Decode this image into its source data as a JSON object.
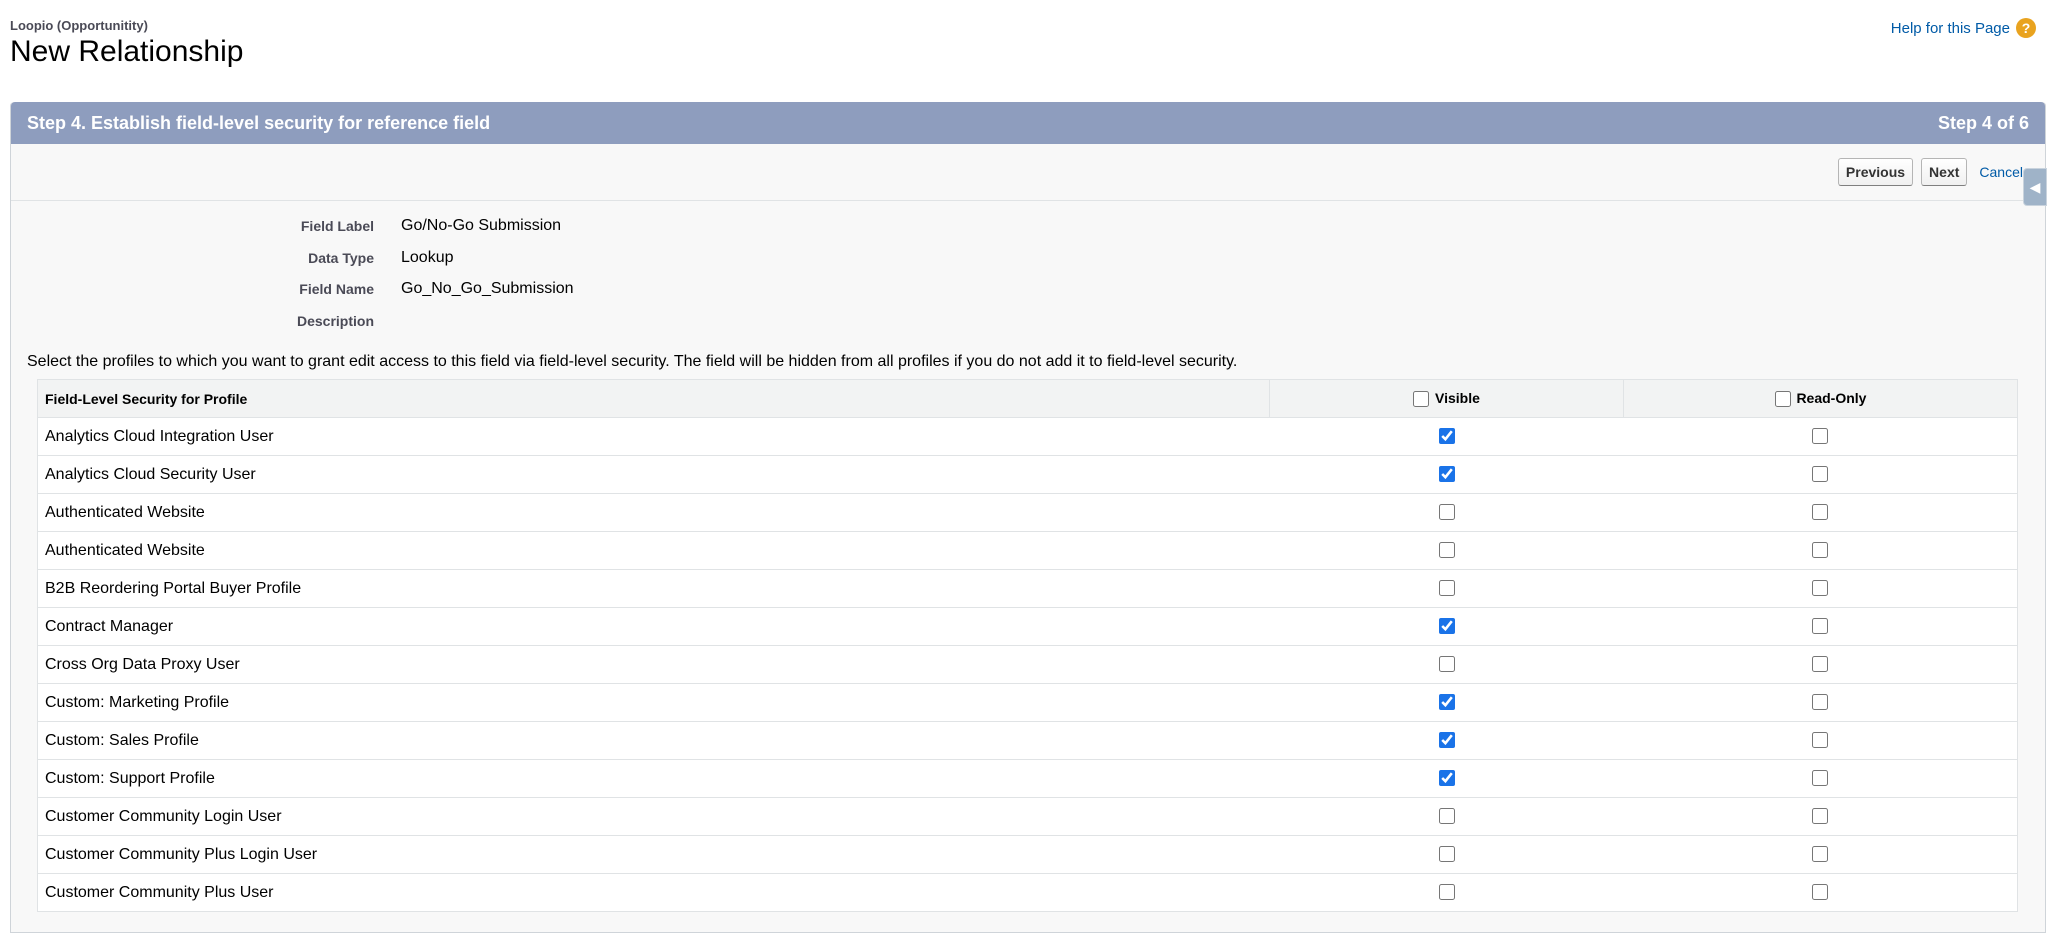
{
  "header": {
    "object_name": "Loopio (Opportunitity)",
    "title": "New Relationship",
    "help_link": "Help for this Page",
    "help_icon": "?"
  },
  "step": {
    "title": "Step 4. Establish field-level security for reference field",
    "progress": "Step 4 of 6"
  },
  "buttons": {
    "previous": "Previous",
    "next": "Next",
    "cancel": "Cancel"
  },
  "details": [
    {
      "label": "Field Label",
      "value": "Go/No-Go Submission"
    },
    {
      "label": "Data Type",
      "value": "Lookup"
    },
    {
      "label": "Field Name",
      "value": "Go_No_Go_Submission"
    },
    {
      "label": "Description",
      "value": ""
    }
  ],
  "instructions": "Select the profiles to which you want to grant edit access to this field via field-level security. The field will be hidden from all profiles if you do not add it to field-level security.",
  "table": {
    "headers": {
      "profile": "Field-Level Security for Profile",
      "visible": "Visible",
      "read_only": "Read-Only"
    },
    "rows": [
      {
        "profile": "Analytics Cloud Integration User",
        "visible": true,
        "read_only": false
      },
      {
        "profile": "Analytics Cloud Security User",
        "visible": true,
        "read_only": false
      },
      {
        "profile": "Authenticated Website",
        "visible": false,
        "read_only": false
      },
      {
        "profile": "Authenticated Website",
        "visible": false,
        "read_only": false
      },
      {
        "profile": "B2B Reordering Portal Buyer Profile",
        "visible": false,
        "read_only": false
      },
      {
        "profile": "Contract Manager",
        "visible": true,
        "read_only": false
      },
      {
        "profile": "Cross Org Data Proxy User",
        "visible": false,
        "read_only": false
      },
      {
        "profile": "Custom: Marketing Profile",
        "visible": true,
        "read_only": false
      },
      {
        "profile": "Custom: Sales Profile",
        "visible": true,
        "read_only": false
      },
      {
        "profile": "Custom: Support Profile",
        "visible": true,
        "read_only": false
      },
      {
        "profile": "Customer Community Login User",
        "visible": false,
        "read_only": false
      },
      {
        "profile": "Customer Community Plus Login User",
        "visible": false,
        "read_only": false
      },
      {
        "profile": "Customer Community Plus User",
        "visible": false,
        "read_only": false
      }
    ]
  },
  "colors": {
    "step_header": "#8e9dbe",
    "link": "#015ba7",
    "help_icon": "#e9a31f",
    "checkbox_checked": "#1a73e8"
  }
}
